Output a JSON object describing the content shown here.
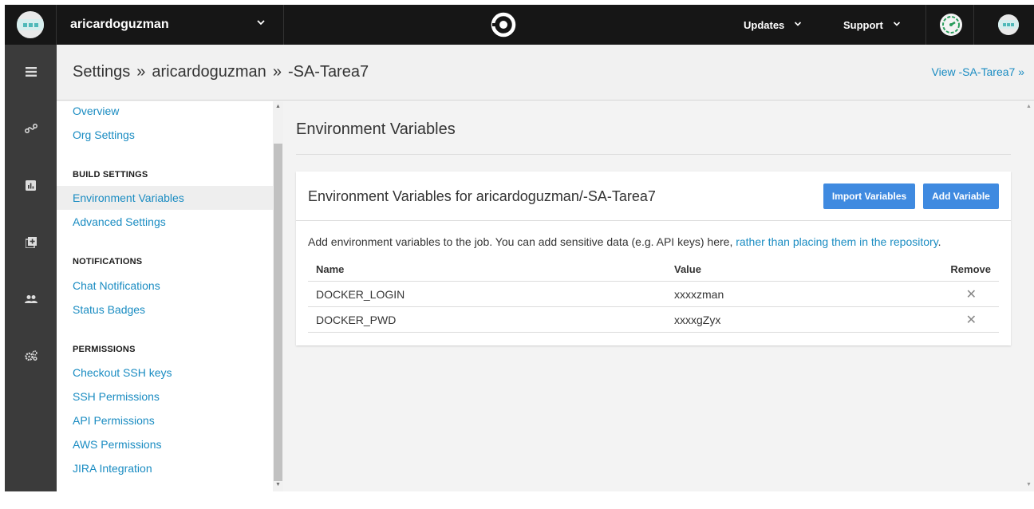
{
  "topbar": {
    "org_name": "aricardoguzman",
    "updates_label": "Updates",
    "support_label": "Support",
    "chevron": "⌄"
  },
  "breadcrumb": {
    "items": [
      "Settings",
      "aricardoguzman",
      "-SA-Tarea7"
    ],
    "separator": "»",
    "view_link": "View -SA-Tarea7 »"
  },
  "sidebar": {
    "links_top": [
      "Overview",
      "Org Settings"
    ],
    "build_heading": "BUILD SETTINGS",
    "build_items": [
      "Environment Variables",
      "Advanced Settings"
    ],
    "notifications_heading": "NOTIFICATIONS",
    "notification_items": [
      "Chat Notifications",
      "Status Badges"
    ],
    "permissions_heading": "PERMISSIONS",
    "permission_items": [
      "Checkout SSH keys",
      "SSH Permissions",
      "API Permissions",
      "AWS Permissions",
      "JIRA Integration"
    ]
  },
  "main": {
    "title": "Environment Variables",
    "card_title": "Environment Variables for aricardoguzman/-SA-Tarea7",
    "import_button": "Import Variables",
    "add_button": "Add Variable",
    "description_text": "Add environment variables to the job. You can add sensitive data (e.g. API keys) here, ",
    "description_link": "rather than placing them in the repository",
    "description_end": ".",
    "table": {
      "headers": [
        "Name",
        "Value",
        "Remove"
      ],
      "rows": [
        {
          "name": "DOCKER_LOGIN",
          "value": "xxxxzman"
        },
        {
          "name": "DOCKER_PWD",
          "value": "xxxxgZyx"
        }
      ],
      "remove_glyph": "✕"
    }
  },
  "colors": {
    "topbar": "#161616",
    "leftnav": "#3b3b3b",
    "link": "#1a8cc2",
    "button": "#3f8ae0"
  },
  "icons": {
    "leftnav": [
      "builds-list-icon",
      "workflows-icon",
      "insights-icon",
      "add-project-icon",
      "team-icon",
      "settings-gears-icon"
    ]
  }
}
